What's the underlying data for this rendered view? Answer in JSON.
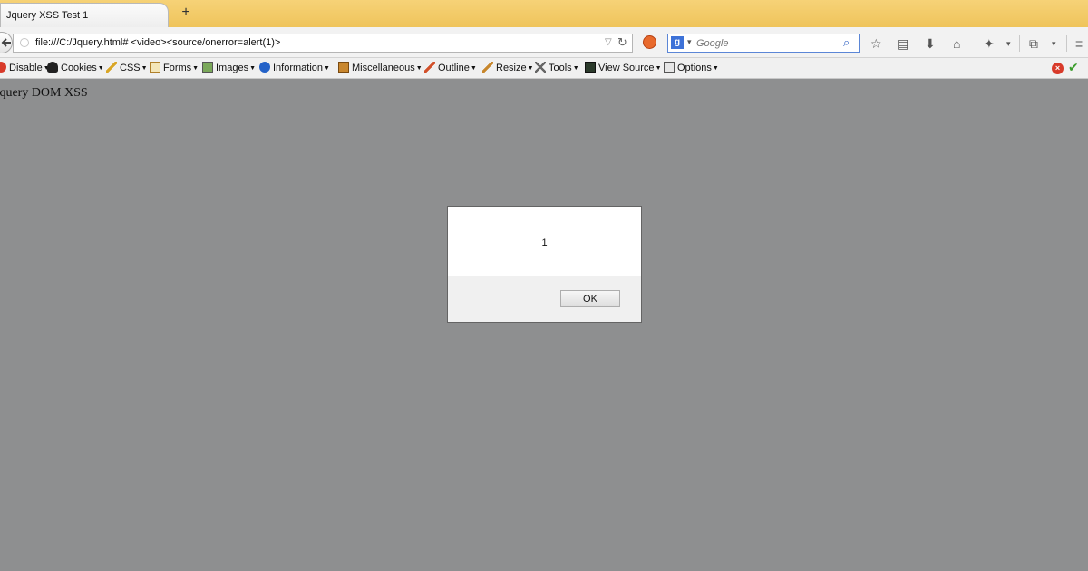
{
  "browser": {
    "tab_title": "Jquery XSS Test 1",
    "new_tab": "+",
    "url": "file:///C:/Jquery.html# <video><source/onerror=alert(1)>",
    "search": {
      "engine": "g",
      "placeholder": "Google"
    }
  },
  "devtoolbar": {
    "items": [
      {
        "label": "Disable",
        "icon": "disable-icon"
      },
      {
        "label": "Cookies",
        "icon": "cookies-icon"
      },
      {
        "label": "CSS",
        "icon": "css-pencil-icon"
      },
      {
        "label": "Forms",
        "icon": "forms-clipboard-icon"
      },
      {
        "label": "Images",
        "icon": "images-icon"
      },
      {
        "label": "Information",
        "icon": "information-icon"
      },
      {
        "label": "Miscellaneous",
        "icon": "miscellaneous-icon"
      },
      {
        "label": "Outline",
        "icon": "outline-pencil-icon"
      },
      {
        "label": "Resize",
        "icon": "resize-icon"
      },
      {
        "label": "Tools",
        "icon": "tools-icon"
      },
      {
        "label": "View Source",
        "icon": "view-source-icon"
      },
      {
        "label": "Options",
        "icon": "options-icon"
      }
    ],
    "status_error": "×",
    "status_ok": "✔"
  },
  "page": {
    "heading": "Jquery DOM XSS"
  },
  "dialog": {
    "message": "1",
    "ok_label": "OK"
  },
  "colors": {
    "tabstrip": "#efc45b",
    "page_background": "#8e8f90",
    "dialog_background": "#f0f0f0"
  }
}
